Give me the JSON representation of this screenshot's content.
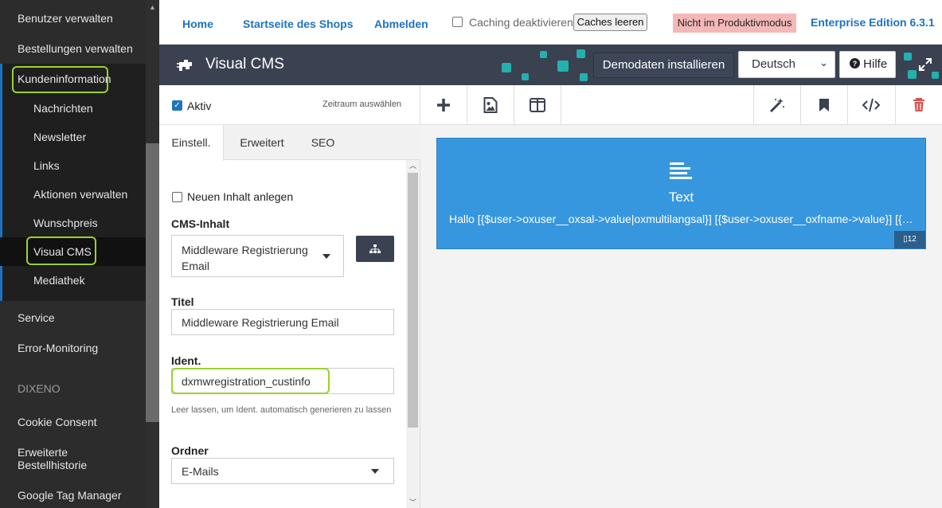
{
  "sidebar": {
    "items": [
      {
        "label": "Benutzer verwalten"
      },
      {
        "label": "Bestellungen verwalten"
      },
      {
        "label": "Kundeninformation"
      },
      {
        "label": "Service"
      },
      {
        "label": "Error-Monitoring"
      },
      {
        "label": "DIXENO"
      },
      {
        "label": "Cookie Consent"
      },
      {
        "label": "Erweiterte Bestellhistorie"
      },
      {
        "label": "Google Tag Manager"
      }
    ],
    "subitems": [
      {
        "label": "Nachrichten"
      },
      {
        "label": "Newsletter"
      },
      {
        "label": "Links"
      },
      {
        "label": "Aktionen verwalten"
      },
      {
        "label": "Wunschpreis"
      },
      {
        "label": "Visual CMS"
      },
      {
        "label": "Mediathek"
      }
    ]
  },
  "topbar": {
    "home": "Home",
    "shop_start": "Startseite des Shops",
    "logout": "Abmelden",
    "caching_label": "Caching deaktivieren",
    "clear_cache": "Caches leeren",
    "mode_badge": "Nicht im Produktivmodus",
    "edition": "Enterprise Edition 6.3.1"
  },
  "vcms": {
    "title": "Visual CMS",
    "demo_button": "Demodaten installieren",
    "language": "Deutsch",
    "help": "Hilfe",
    "accent_color": "#23b6b3"
  },
  "panel": {
    "aktiv_label": "Aktiv",
    "zeitraum": "Zeitraum auswählen",
    "tabs": [
      {
        "label": "Einstell."
      },
      {
        "label": "Erweitert"
      },
      {
        "label": "SEO"
      }
    ],
    "new_content_label": "Neuen Inhalt anlegen",
    "cms_content_label": "CMS-Inhalt",
    "cms_content_value": "Middleware Registrierung Email",
    "title_label": "Titel",
    "title_value": "Middleware Registrierung Email",
    "ident_label": "Ident.",
    "ident_value": "dxmwregistration_custinfo",
    "ident_hint": "Leer lassen, um Ident. automatisch generieren zu lassen",
    "folder_label": "Ordner",
    "folder_value": "E-Mails"
  },
  "canvas": {
    "widget_title": "Text",
    "widget_content": "Hallo [{$user->oxuser__oxsal->value|oxmultilangsal}] [{$user->oxuser__oxfname->value}] [{$user->oxuser__oxlname->value}],",
    "widget_id": "12",
    "widget_color": "#3797de"
  }
}
